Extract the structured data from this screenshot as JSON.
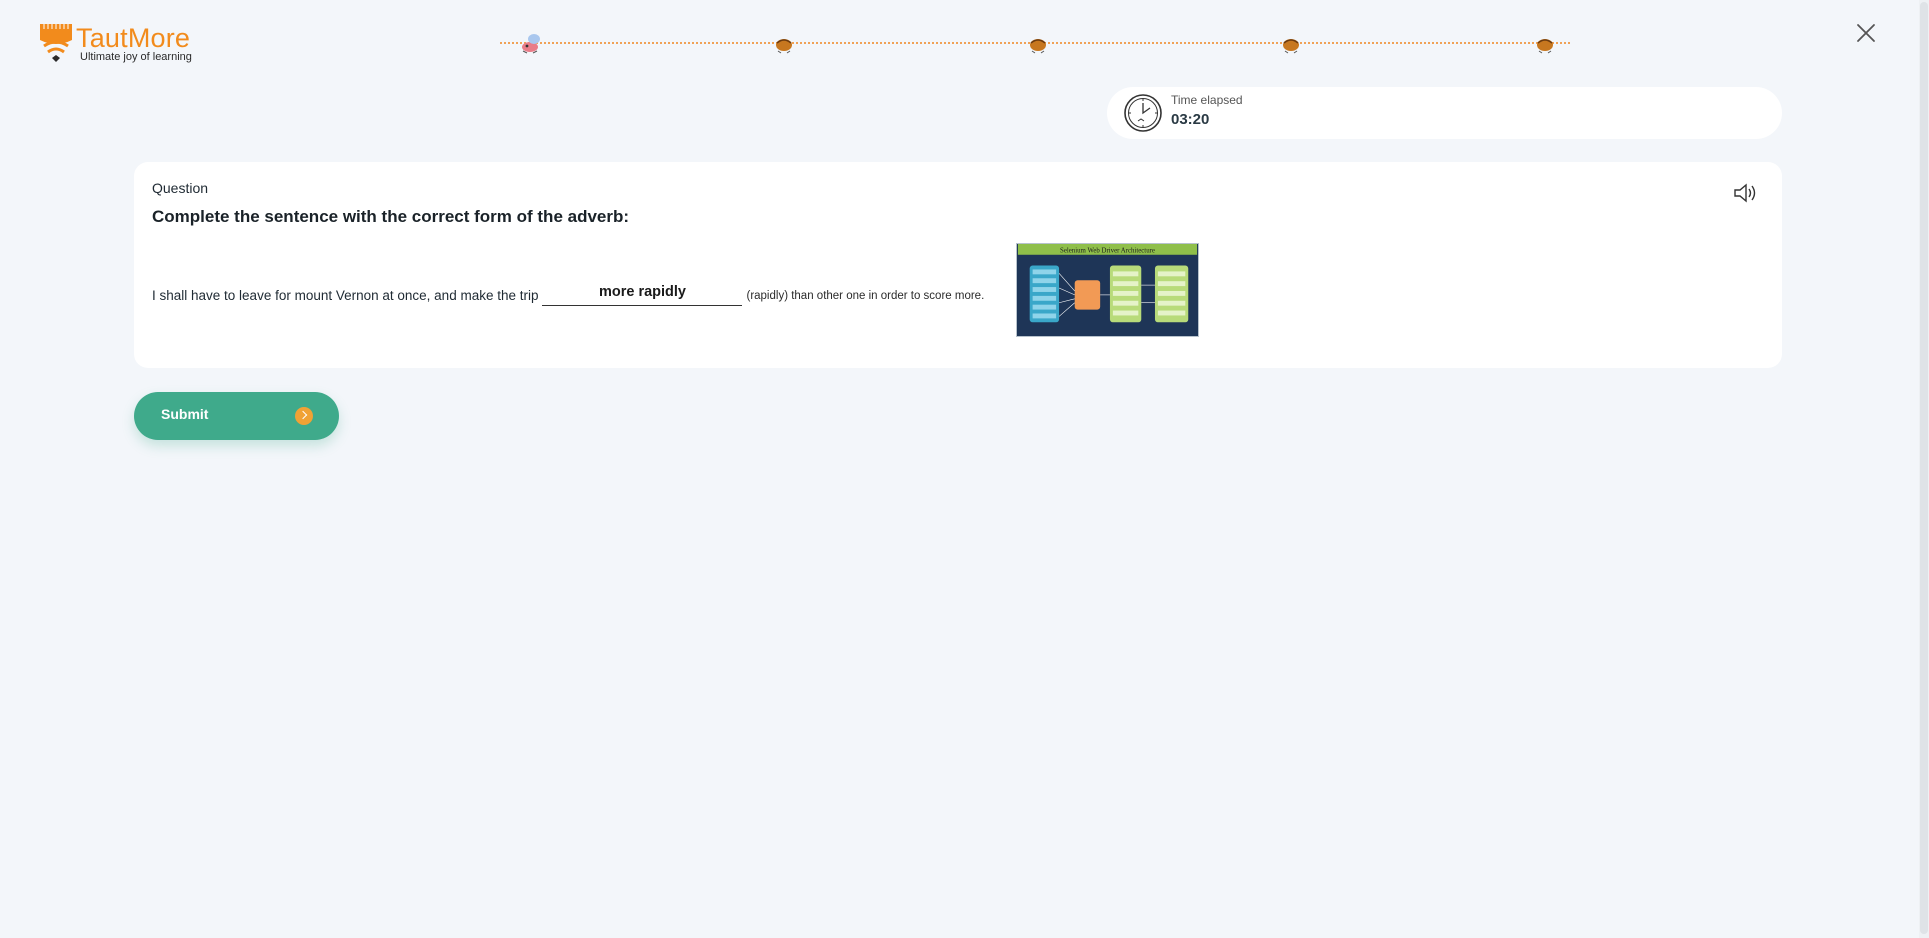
{
  "brand": {
    "name": "TautMore",
    "tagline": "Ultimate joy of learning",
    "accent_color": "#f28b1c"
  },
  "progress": {
    "steps": [
      {
        "icon": "bird-icon",
        "state": "current"
      },
      {
        "icon": "bird-icon",
        "state": "pending"
      },
      {
        "icon": "bird-icon",
        "state": "pending"
      },
      {
        "icon": "bird-icon",
        "state": "pending"
      },
      {
        "icon": "bird-icon",
        "state": "pending"
      }
    ],
    "line_color": "#f0a257"
  },
  "timer": {
    "label": "Time elapsed",
    "value": "03:20",
    "icon": "clock-icon"
  },
  "question": {
    "label": "Question",
    "title": "Complete the sentence with the correct form of the adverb:",
    "sentence_before": "I shall have to leave for mount Vernon at once, and make the trip",
    "answer_value": "more rapidly",
    "sentence_after": "(rapidly) than other one in order to score more.",
    "image_title": "Selenium Web Driver Architecture",
    "speaker_icon": "speaker-icon"
  },
  "submit": {
    "label": "Submit",
    "color": "#3faa8b",
    "arrow_color": "#f0a235"
  },
  "close_icon": "close-icon"
}
